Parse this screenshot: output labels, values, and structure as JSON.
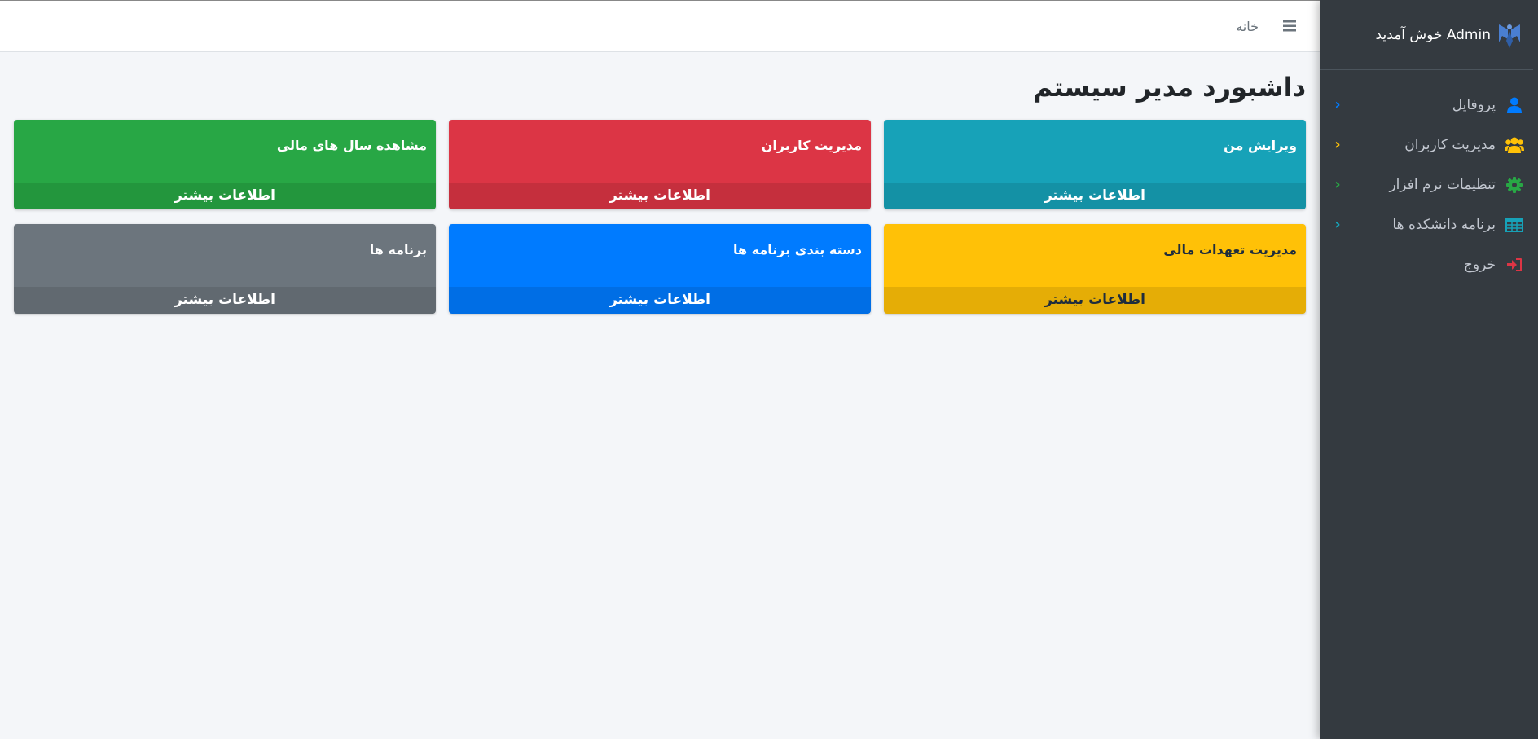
{
  "sidebar": {
    "brand_text": "Admin خوش آمدید",
    "items": [
      {
        "label": "پروفایل",
        "icon": "user-icon",
        "icon_color": "#007bff",
        "chevron_color": "#007bff"
      },
      {
        "label": "مدیریت کاربران",
        "icon": "users-icon",
        "icon_color": "#ffc107",
        "chevron_color": "#ffc107"
      },
      {
        "label": "تنظیمات نرم افزار",
        "icon": "gear-icon",
        "icon_color": "#28a745",
        "chevron_color": "#28a745"
      },
      {
        "label": "برنامه دانشکده ها",
        "icon": "table-icon",
        "icon_color": "#17a2b8",
        "chevron_color": "#17a2b8"
      },
      {
        "label": "خروج",
        "icon": "sign-out-icon",
        "icon_color": "#dc3545"
      }
    ]
  },
  "navbar": {
    "home_label": "خانه"
  },
  "main": {
    "page_title": "داشبورد مدیر سیستم",
    "cards": [
      {
        "title": "ویرایش من",
        "footer": "اطلاعات بیشتر",
        "color": "#17a2b8"
      },
      {
        "title": "مدیریت کاربران",
        "footer": "اطلاعات بیشتر",
        "color": "#dc3545"
      },
      {
        "title": "مشاهده سال های مالی",
        "footer": "اطلاعات بیشتر",
        "color": "#28a745"
      },
      {
        "title": "مدیریت تعهدات مالی",
        "footer": "اطلاعات بیشتر",
        "color": "#ffc107"
      },
      {
        "title": "دسته بندی برنامه ها",
        "footer": "اطلاعات بیشتر",
        "color": "#007bff"
      },
      {
        "title": "برنامه ها",
        "footer": "اطلاعات بیشتر",
        "color": "#6c757d"
      }
    ]
  }
}
